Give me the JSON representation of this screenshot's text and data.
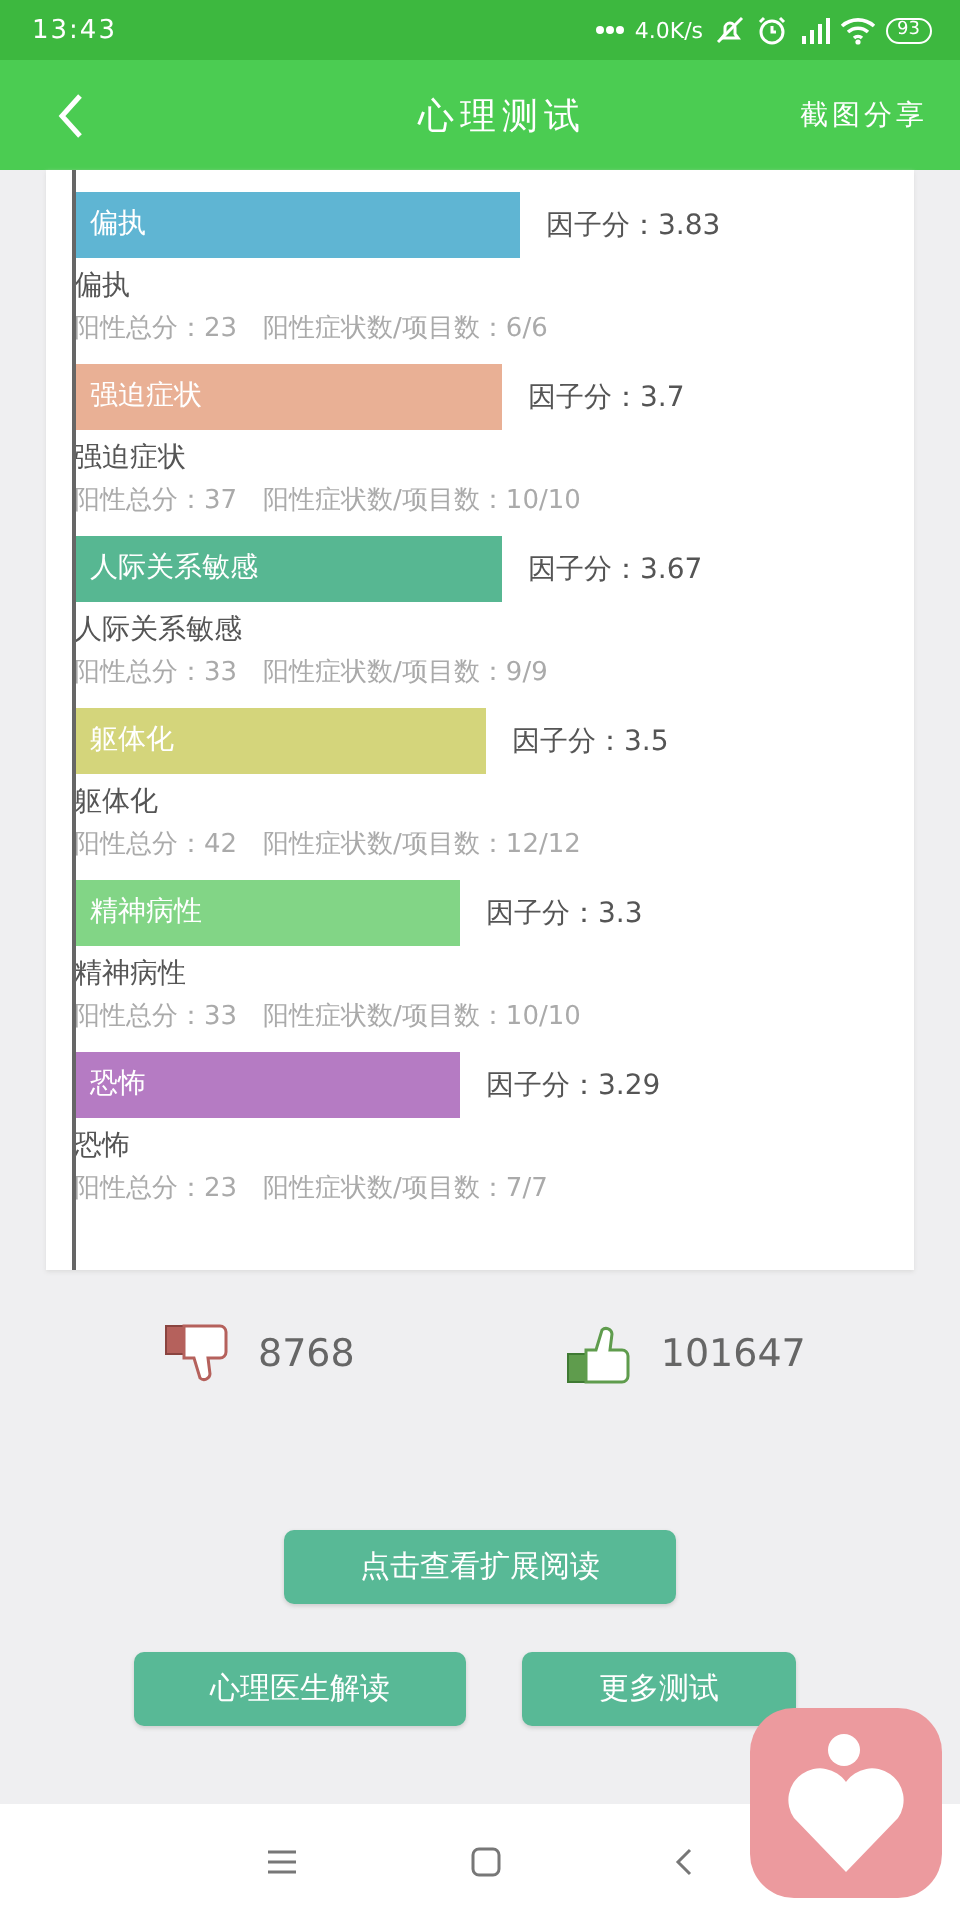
{
  "status_bar": {
    "time": "13:43",
    "net_speed": "4.0K/s",
    "battery": "93"
  },
  "header": {
    "title": "心理测试",
    "action": "截图分享"
  },
  "factors": [
    {
      "name": "偏执",
      "score_label": "因子分：3.83",
      "color": "#5fb5d3",
      "caption": "偏执",
      "stats": "阳性总分：23　阳性症状数/项目数：6/6"
    },
    {
      "name": "强迫症状",
      "score_label": "因子分：3.7",
      "color": "#e9b095",
      "caption": "强迫症状",
      "stats": "阳性总分：37　阳性症状数/项目数：10/10"
    },
    {
      "name": "人际关系敏感",
      "score_label": "因子分：3.67",
      "color": "#57b792",
      "caption": "人际关系敏感",
      "stats": "阳性总分：33　阳性症状数/项目数：9/9"
    },
    {
      "name": "躯体化",
      "score_label": "因子分：3.5",
      "color": "#d4d57b",
      "caption": "躯体化",
      "stats": "阳性总分：42　阳性症状数/项目数：12/12"
    },
    {
      "name": "精神病性",
      "score_label": "因子分：3.3",
      "color": "#82d586",
      "caption": "精神病性",
      "stats": "阳性总分：33　阳性症状数/项目数：10/10"
    },
    {
      "name": "恐怖",
      "score_label": "因子分：3.29",
      "color": "#b57bc3",
      "caption": "恐怖",
      "stats": "阳性总分：23　阳性症状数/项目数：7/7"
    }
  ],
  "votes": {
    "dislikes": "8768",
    "likes": "101647"
  },
  "buttons": [
    {
      "label": "点击查看扩展阅读"
    },
    {
      "label": "心理医生解读"
    },
    {
      "label": "更多测试"
    }
  ]
}
